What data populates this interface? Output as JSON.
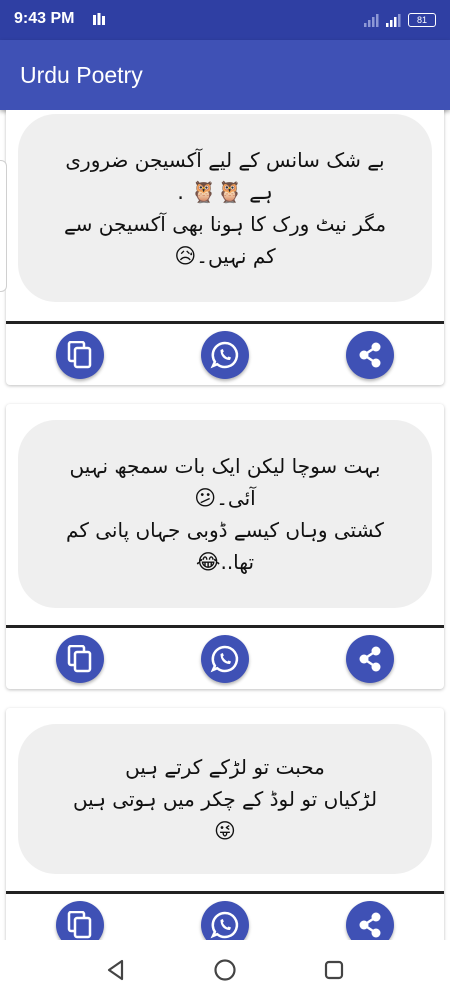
{
  "status_bar": {
    "time": "9:43 PM",
    "battery": "81"
  },
  "app_bar": {
    "title": "Urdu Poetry"
  },
  "poems": [
    {
      "lines": [
        "بے شک سانس کے لیے آکسیجن ضروری",
        "ہے",
        "مگر نیٹ ورک کا ہونا بھی آکسیجن سے",
        "کم نہیں۔"
      ],
      "emojis": [
        "🦉🦉 .",
        "😥"
      ]
    },
    {
      "lines": [
        "بہت سوچا لیکن ایک بات سمجھ نہیں",
        "آئی۔",
        "کشتی وہاں کیسے ڈوبی جہاں پانی کم",
        "تھا.."
      ],
      "emojis": [
        "😕",
        "😂"
      ]
    },
    {
      "lines": [
        "محبت تو لڑکے کرتے ہیں",
        "لڑکیاں تو لوڈ کے چکر میں ہوتی ہیں"
      ],
      "emojis": [
        "😜"
      ]
    }
  ],
  "actions": {
    "copy": "copy-icon",
    "whatsapp": "whatsapp-icon",
    "share": "share-icon"
  },
  "colors": {
    "primary": "#3f51b5",
    "status_bar": "#2f3fa3",
    "bubble": "#efefef"
  }
}
